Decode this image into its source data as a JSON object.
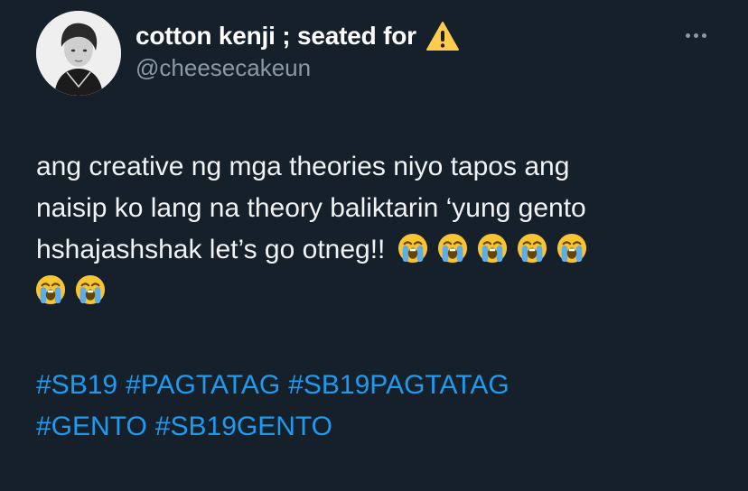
{
  "author": {
    "display_name": "cotton kenji ; seated for",
    "name_emoji": "warning-icon",
    "handle": "@cheesecakeun"
  },
  "tweet": {
    "lines": [
      "ang creative ng mga theories niyo tapos ang",
      "naisip ko lang na theory baliktarin ‘yung gento",
      "hshajashshak let’s go otneg!!"
    ],
    "emojis": [
      "loudly-crying-face-icon",
      "loudly-crying-face-icon",
      "loudly-crying-face-icon",
      "loudly-crying-face-icon",
      "loudly-crying-face-icon",
      "loudly-crying-face-icon",
      "loudly-crying-face-icon"
    ],
    "hashtags": [
      [
        "#SB19",
        "#PAGTATAG",
        "#SB19PAGTATAG"
      ],
      [
        "#GENTO",
        "#SB19GENTO"
      ]
    ]
  },
  "colors": {
    "background": "#15202b",
    "text": "#f1f3f5",
    "secondary": "#8b98a5",
    "link": "#1d9bf0"
  }
}
